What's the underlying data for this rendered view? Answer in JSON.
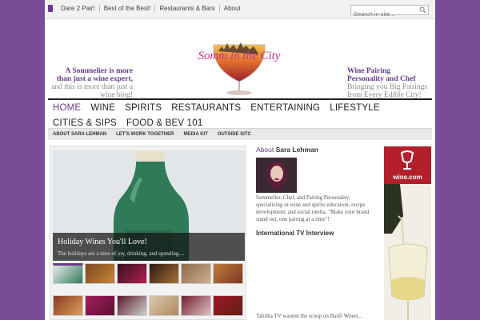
{
  "topbar": {
    "links": [
      "Dare 2 Pair!",
      "Best of the Best!",
      "Restaurants & Bars",
      "About"
    ],
    "search_placeholder": "Search in site..."
  },
  "header": {
    "logo_text": "Somm in the City",
    "tagline_left": [
      "A Sommelier is more",
      "than just a wine expert,",
      "and this is more than just a",
      "wine blog!"
    ],
    "tagline_right": [
      "Wine Pairing",
      "Personality and Chef",
      "Bringing you Big Pairings",
      "from Every Edible City!"
    ]
  },
  "main_nav": [
    "HOME",
    "WINE",
    "SPIRITS",
    "RESTAURANTS",
    "ENTERTAINING",
    "LIFESTYLE",
    "CITIES & SIPS",
    "FOOD & BEV 101"
  ],
  "sub_nav": [
    "ABOUT SARA LEHMAN",
    "LET'S WORK TOGETHER",
    "MEDIA KIT",
    "OUTSIDE SITC"
  ],
  "slider": {
    "title": "Holiday Wines You'll Love!",
    "excerpt": "The holidays are a time of joy, drinking, and spending...."
  },
  "about": {
    "heading_prefix": "About",
    "heading_name": "Sara Lehman",
    "bio": "Sommelier, Chef, and Pairing Personality, specializing in wine and spirits education, recipe development, and social media. \"Make your brand stand out, one pairing at a time\"!",
    "tv_heading": "International TV Interview",
    "tv_text": "Tabitha TV wanted the scoop on Banfi Wines..."
  },
  "ad": {
    "brand": "wine.com"
  },
  "colors": {
    "accent": "#6a3a8c",
    "background": "#7a4b97",
    "ad_red": "#b2202c"
  }
}
